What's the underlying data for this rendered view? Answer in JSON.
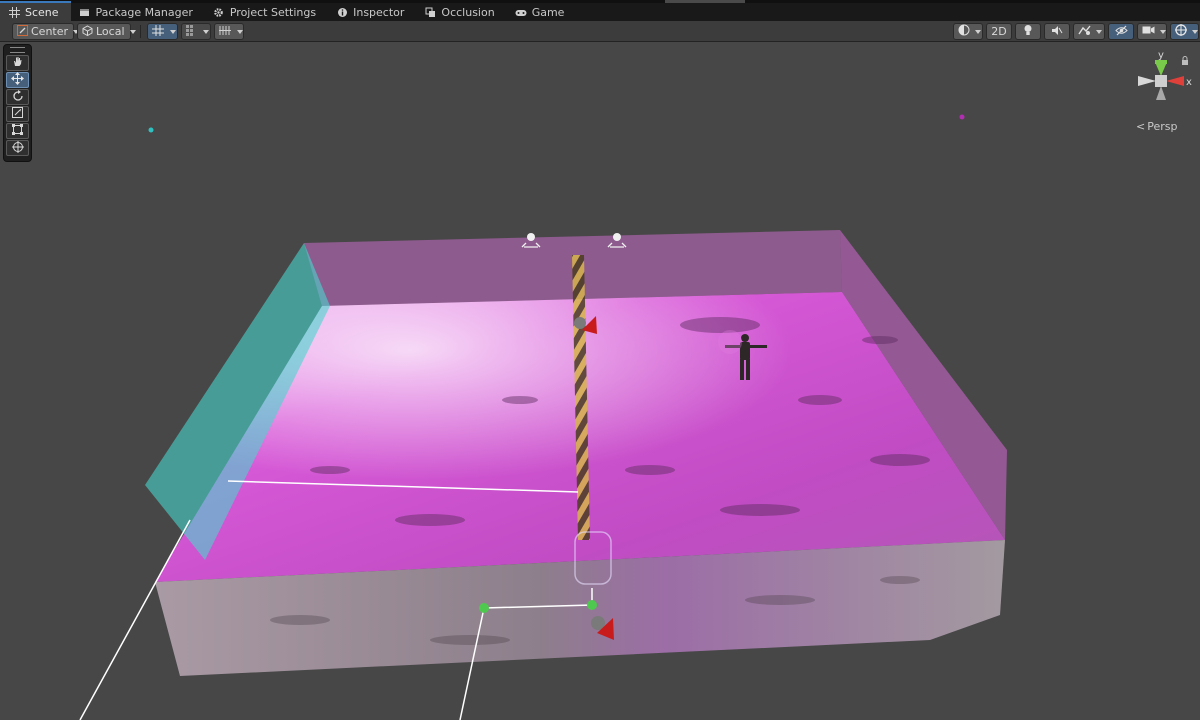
{
  "tabs": [
    {
      "label": "Scene",
      "icon": "grid-icon",
      "active": true
    },
    {
      "label": "Package Manager",
      "icon": "package-icon",
      "active": false
    },
    {
      "label": "Project Settings",
      "icon": "gear-icon",
      "active": false
    },
    {
      "label": "Inspector",
      "icon": "info-icon",
      "active": false
    },
    {
      "label": "Occlusion",
      "icon": "occlusion-icon",
      "active": false
    },
    {
      "label": "Game",
      "icon": "gamepad-icon",
      "active": false
    }
  ],
  "toolbar": {
    "pivot_label": "Center",
    "space_label": "Local",
    "mode_2d_label": "2D"
  },
  "tools": [
    "hand-tool",
    "move-tool",
    "rotate-tool",
    "scale-tool",
    "rect-tool",
    "transform-tool"
  ],
  "active_tool": "move-tool",
  "gizmo": {
    "y_label": "y",
    "x_label": "x",
    "projection_label": "Persp"
  },
  "colors": {
    "accent": "#46607c",
    "selection": "#3a79bb",
    "trigger_magenta": "#e04de0",
    "trigger_cyan": "#3fd1cc"
  }
}
